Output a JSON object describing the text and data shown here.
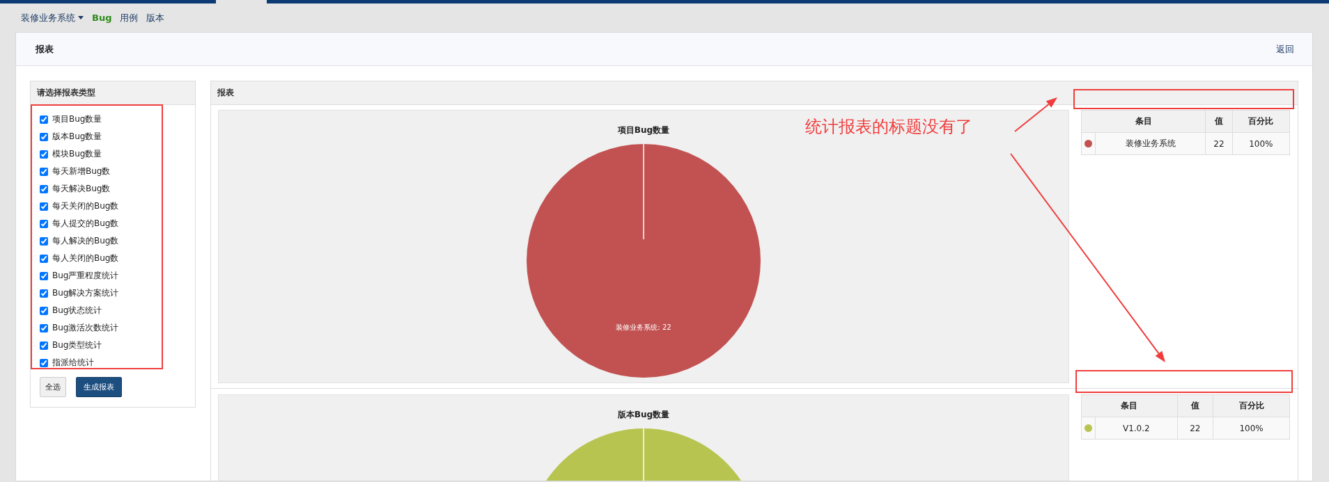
{
  "top_nav": {
    "items": [
      {
        "label": "装修业务系统",
        "kind": "dropdown",
        "selected": false
      },
      {
        "label": "Bug",
        "kind": "link",
        "selected": true
      },
      {
        "label": "用例",
        "kind": "link",
        "selected": false
      },
      {
        "label": "版本",
        "kind": "link",
        "selected": false
      }
    ]
  },
  "page_header": {
    "title": "报表",
    "back_link": "返回"
  },
  "report_types": {
    "title": "请选择报表类型",
    "options": [
      {
        "label": "项目Bug数量",
        "checked": true
      },
      {
        "label": "版本Bug数量",
        "checked": true
      },
      {
        "label": "模块Bug数量",
        "checked": true
      },
      {
        "label": "每天新增Bug数",
        "checked": true
      },
      {
        "label": "每天解决Bug数",
        "checked": true
      },
      {
        "label": "每天关闭的Bug数",
        "checked": true
      },
      {
        "label": "每人提交的Bug数",
        "checked": true
      },
      {
        "label": "每人解决的Bug数",
        "checked": true
      },
      {
        "label": "每人关闭的Bug数",
        "checked": true
      },
      {
        "label": "Bug严重程度统计",
        "checked": true
      },
      {
        "label": "Bug解决方案统计",
        "checked": true
      },
      {
        "label": "Bug状态统计",
        "checked": true
      },
      {
        "label": "Bug激活次数统计",
        "checked": true
      },
      {
        "label": "Bug类型统计",
        "checked": true
      },
      {
        "label": "指派给统计",
        "checked": true
      }
    ],
    "buttons": [
      {
        "label": "全选",
        "kind": "default"
      },
      {
        "label": "生成报表",
        "kind": "primary"
      }
    ]
  },
  "reports": {
    "title": "报表",
    "charts": [
      {
        "title": "项目Bug数量",
        "slice_label": "装修业务系统: 22",
        "table": {
          "columns": [
            "条目",
            "值",
            "百分比"
          ],
          "rows": [
            {
              "color": "#c25252",
              "item": "装修业务系统",
              "value": "22",
              "percent": "100%"
            }
          ]
        }
      },
      {
        "title": "版本Bug数量",
        "table": {
          "columns": [
            "条目",
            "值",
            "百分比"
          ],
          "rows": [
            {
              "color": "#b8c450",
              "item": "V1.0.2",
              "value": "22",
              "percent": "100%"
            }
          ]
        }
      }
    ]
  },
  "annotation": {
    "text": "统计报表的标题没有了"
  }
}
